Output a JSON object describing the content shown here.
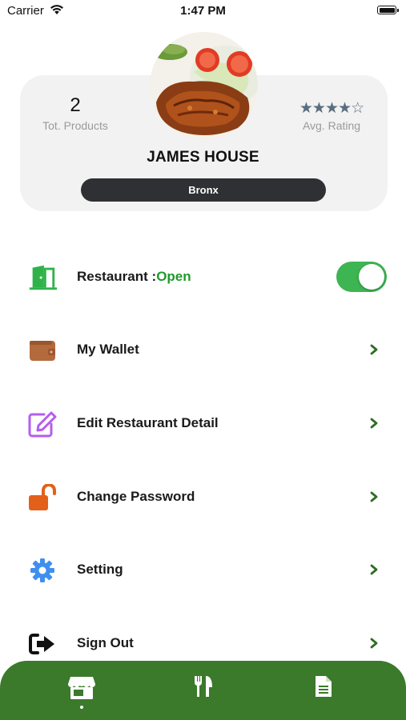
{
  "status_bar": {
    "carrier": "Carrier",
    "time": "1:47 PM",
    "icons": [
      "wifi-icon",
      "battery-icon"
    ]
  },
  "profile": {
    "total_products_value": "2",
    "total_products_label": "Tot. Products",
    "rating_value": 4,
    "rating_max": 5,
    "rating_label": "Avg. Rating",
    "restaurant_name": "JAMES HOUSE",
    "location": "Bronx",
    "avatar_alt": "restaurant-photo"
  },
  "menu": {
    "restaurant_label": "Restaurant :",
    "restaurant_status": "Open",
    "restaurant_toggle_on": true,
    "wallet_label": "My Wallet",
    "edit_label": "Edit Restaurant Detail",
    "password_label": "Change Password",
    "setting_label": "Setting",
    "signout_label": "Sign Out"
  },
  "tab_bar": {
    "tabs": [
      "store-icon",
      "utensils-icon",
      "document-icon"
    ],
    "active_index": 0
  },
  "colors": {
    "accent_green": "#3a7a2a",
    "toggle_green": "#3db552",
    "open_text": "#1f9a2a",
    "wallet_brown": "#b36a3c",
    "edit_purple": "#b45df0",
    "lock_orange": "#e3601a",
    "gear_blue": "#3f8ff0"
  }
}
